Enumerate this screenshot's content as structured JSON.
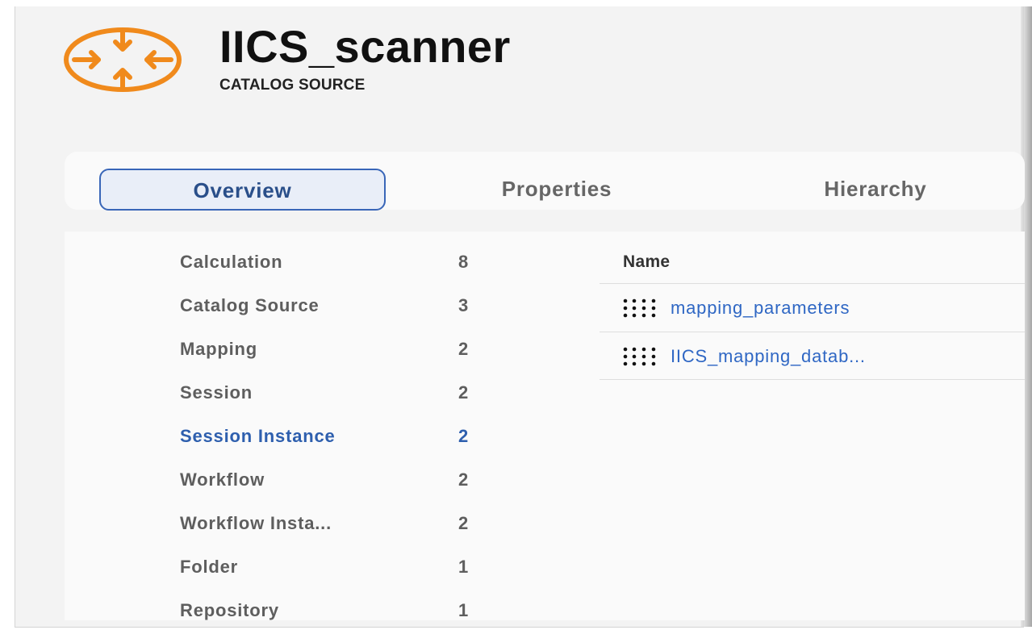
{
  "header": {
    "icon": "catalog-source-icon",
    "title": "IICS_scanner",
    "subtitle": "CATALOG SOURCE",
    "accent_color": "#f08a1c"
  },
  "tabs": [
    {
      "label": "Overview",
      "active": true
    },
    {
      "label": "Properties",
      "active": false
    },
    {
      "label": "Hierarchy",
      "active": false
    }
  ],
  "categories": [
    {
      "label": "Calculation",
      "count": "8"
    },
    {
      "label": "Catalog Source",
      "count": "3"
    },
    {
      "label": "Mapping",
      "count": "2"
    },
    {
      "label": "Session",
      "count": "2"
    },
    {
      "label": "Session Instance",
      "count": "2",
      "active": true
    },
    {
      "label": "Workflow",
      "count": "2"
    },
    {
      "label": "Workflow Insta...",
      "count": "2"
    },
    {
      "label": "Folder",
      "count": "1"
    },
    {
      "label": "Repository",
      "count": "1"
    }
  ],
  "results": {
    "column_header": "Name",
    "rows": [
      {
        "icon": "drag-handle-icon",
        "name": "mapping_parameters"
      },
      {
        "icon": "drag-handle-icon",
        "name": "IICS_mapping_datab..."
      }
    ]
  },
  "colors": {
    "active_blue": "#2e5fae",
    "link_blue": "#2f67c4"
  }
}
